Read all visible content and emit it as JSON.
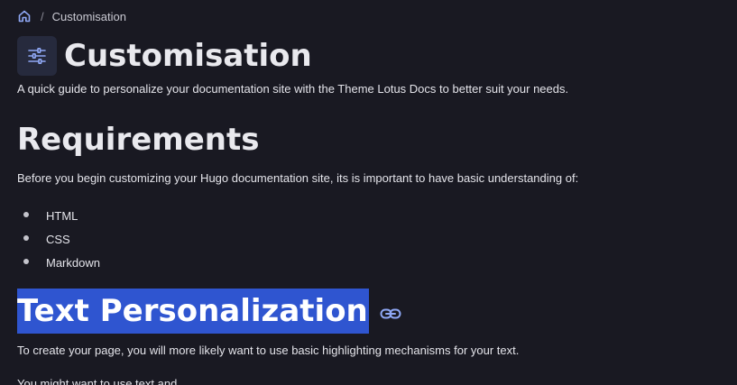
{
  "breadcrumb": {
    "home_icon": "home-icon",
    "separator": "/",
    "current": "Customisation"
  },
  "header": {
    "icon": "sliders-icon",
    "title": "Customisation",
    "lead": "A quick guide to personalize your documentation site with the Theme Lotus Docs to better suit your needs."
  },
  "sections": {
    "requirements": {
      "heading": "Requirements",
      "intro": "Before you begin customizing your Hugo documentation site, its is important to have basic understanding of:",
      "items": [
        "HTML",
        "CSS",
        "Markdown"
      ]
    },
    "text_personalization": {
      "heading": "Text Personalization",
      "anchor_icon": "link-icon",
      "intro": "To create your page, you will more likely want to use basic highlighting mechanisms for your text.",
      "partial": "You might want to use text and ..."
    }
  },
  "colors": {
    "background": "#191922",
    "accent": "#2f55d0",
    "icon_blue": "#8fa8f5"
  }
}
